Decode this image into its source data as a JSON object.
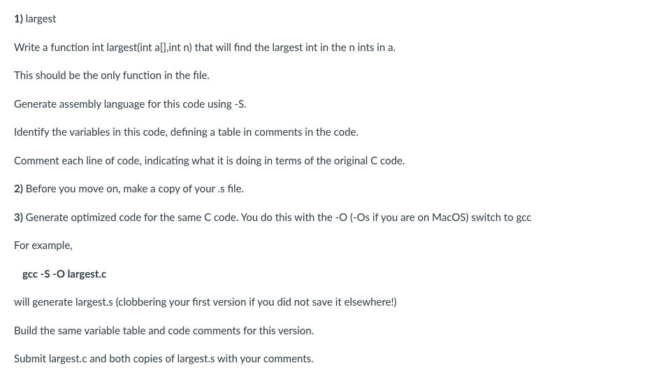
{
  "lines": {
    "l1_num": "1)",
    "l1_text": " largest",
    "l2": "Write a function int largest(int a[],int n) that will find the largest int in the n ints in a.",
    "l3": "This should be the only function in the file.",
    "l4": "Generate assembly language for this code using -S.",
    "l5": "Identify the variables in this code, defining a table in comments in the code.",
    "l6": "Comment each line of code, indicating what it is doing in terms of the original C code.",
    "l7_num": "2)",
    "l7_text": " Before you move on, make a copy of your .s file.",
    "l8_num": "3)",
    "l8_text": " Generate optimized code for the same C code. You do this with the -O (-Os if you are on MacOS) switch to gcc",
    "l9": "For example,",
    "l10": "gcc -S -O largest.c",
    "l11": "will generate largest.s (clobbering your first version if you did not save it elsewhere!)",
    "l12": "Build the same variable table and code comments for this version.",
    "l13": "Submit largest.c and both copies of largest.s with your comments."
  }
}
